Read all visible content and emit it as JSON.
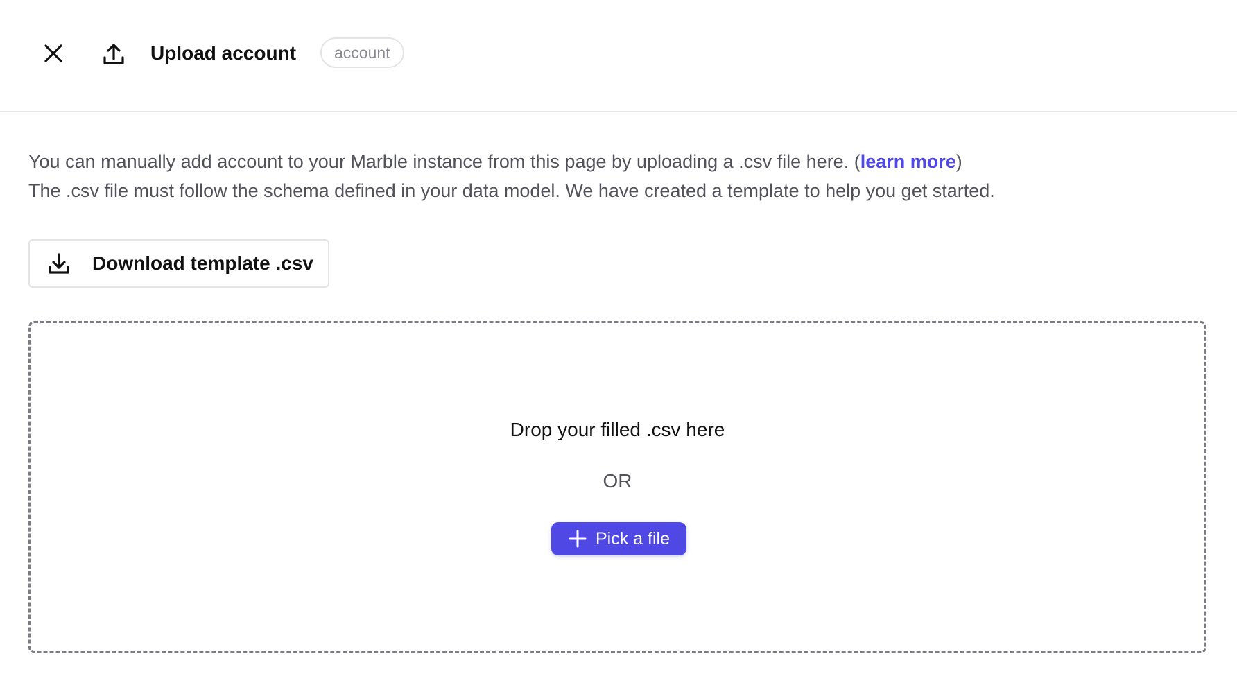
{
  "header": {
    "title": "Upload account",
    "tag": "account",
    "icons": {
      "close": "close-icon",
      "upload": "upload-icon"
    }
  },
  "description": {
    "line1_text": "You can manually add account to your Marble instance from this page by uploading a .csv file here. (",
    "link_label": "learn more",
    "line1_suffix": ")",
    "line2_text": "The .csv file must follow the schema defined in your data model. We have created a template to help you get started."
  },
  "download": {
    "label": "Download template .csv",
    "icon": "download-icon"
  },
  "dropzone": {
    "drop_text": "Drop your filled .csv here",
    "or_text": "OR",
    "pick_label": "Pick a file",
    "pick_icon": "plus-icon"
  },
  "colors": {
    "accent": "#5048e5",
    "border": "#e4e4e7",
    "muted_text": "#52525b",
    "tag_text": "#8a8a94",
    "dashed_border": "#7c7c86"
  }
}
